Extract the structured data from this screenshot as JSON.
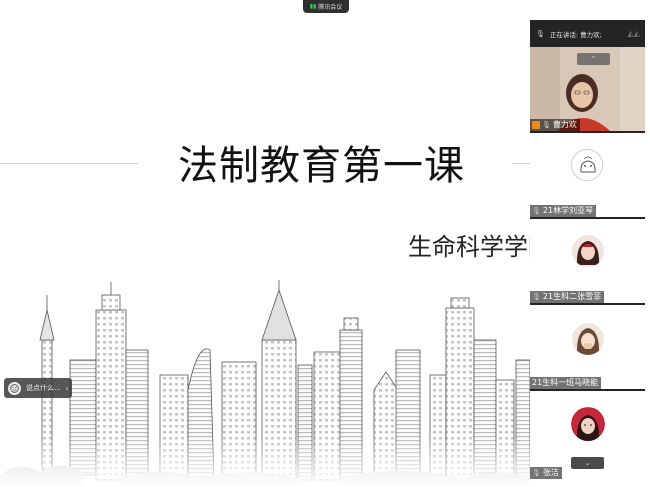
{
  "meeting": {
    "pill_label": "腾讯会议",
    "speaking_label": "正在讲话: 曹力欢;"
  },
  "slide": {
    "title": "法制教育第一课",
    "subtitle": "生命科学学院"
  },
  "chat_widget": {
    "label": "说点什么..."
  },
  "participants": [
    {
      "name": "曹力欢",
      "type": "video",
      "host": true
    },
    {
      "name": "21林学刘亚琴",
      "type": "avatar"
    },
    {
      "name": "21生科二张雪菲",
      "type": "avatar"
    },
    {
      "name": "21生科一班马晓能",
      "type": "avatar"
    },
    {
      "name": "张洁",
      "type": "avatar"
    }
  ],
  "icons": {
    "mic": "mic-icon",
    "host": "host-icon",
    "scroll_up": "chevron-up-icon",
    "scroll_down": "chevron-down-icon"
  }
}
